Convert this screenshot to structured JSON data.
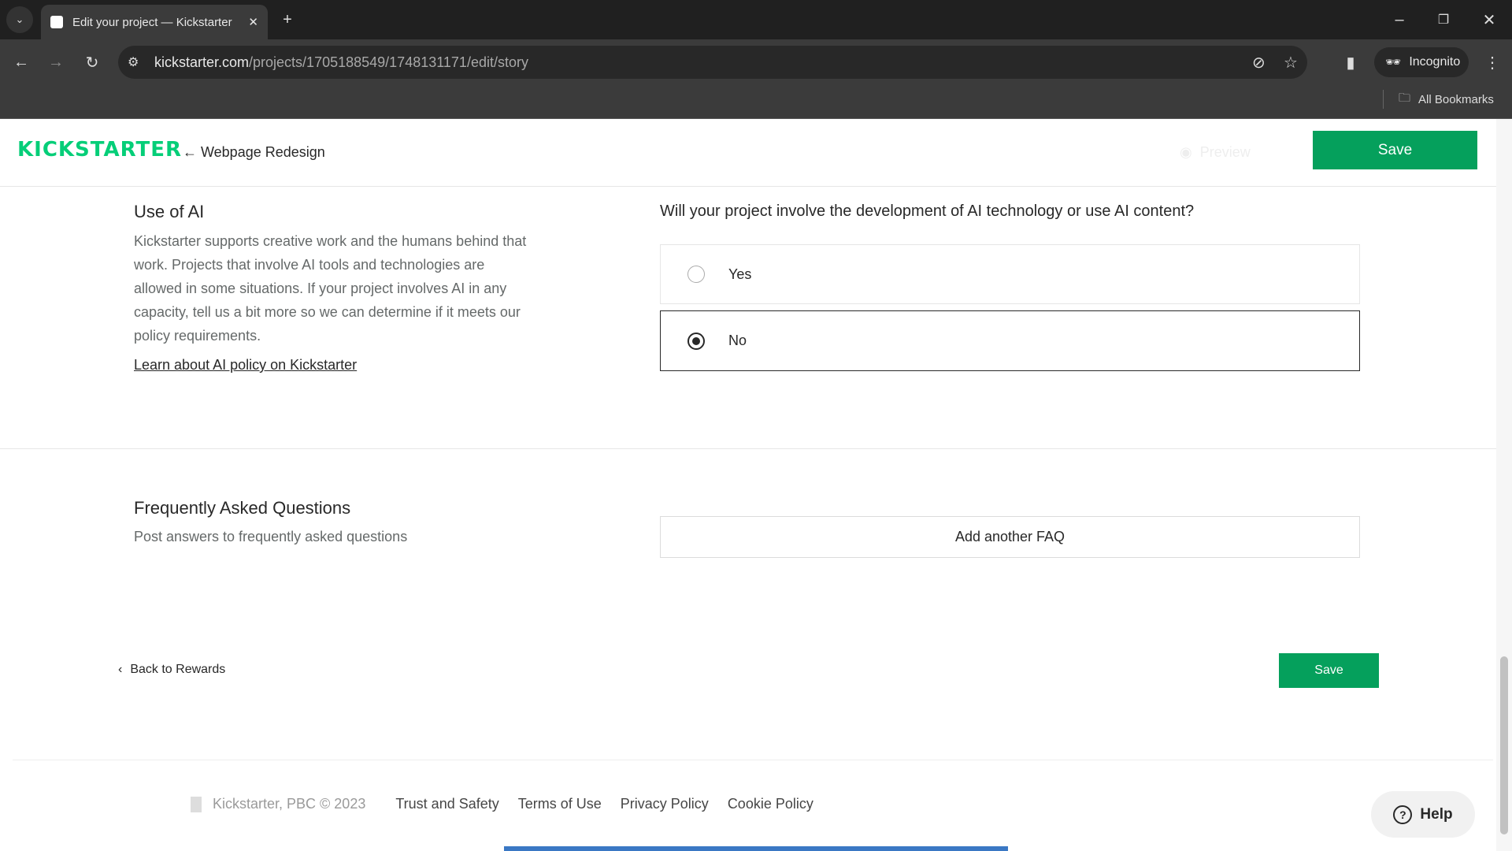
{
  "browser": {
    "tab_title": "Edit your project — Kickstarter",
    "url_domain": "kickstarter.com",
    "url_path": "/projects/1705188549/1748131171/edit/story",
    "incognito_label": "Incognito",
    "bookmarks_label": "All Bookmarks"
  },
  "header": {
    "logo": "KICKSTARTER",
    "back_label": "← Webpage Redesign",
    "preview_label": "Preview",
    "save_label": "Save"
  },
  "ai": {
    "title": "Use of AI",
    "description": "Kickstarter supports creative work and the humans behind that work. Projects that involve AI tools and technologies are allowed in some situations. If your project involves AI in any capacity, tell us a bit more so we can determine if it meets our policy requirements.",
    "link": "Learn about AI policy on Kickstarter",
    "question": "Will your project involve the development of AI technology or use AI content?",
    "options": [
      {
        "label": "Yes",
        "selected": false
      },
      {
        "label": "No",
        "selected": true
      }
    ]
  },
  "faq": {
    "title": "Frequently Asked Questions",
    "subtitle": "Post answers to frequently asked questions",
    "add_label": "Add another FAQ"
  },
  "nav": {
    "back_label": "Back to Rewards",
    "save_label": "Save"
  },
  "footer": {
    "copyright": "Kickstarter, PBC © 2023",
    "links": [
      "Trust and Safety",
      "Terms of Use",
      "Privacy Policy",
      "Cookie Policy"
    ],
    "help_label": "Help"
  },
  "colors": {
    "accent": "#05a05c",
    "logo": "#05ce78"
  }
}
